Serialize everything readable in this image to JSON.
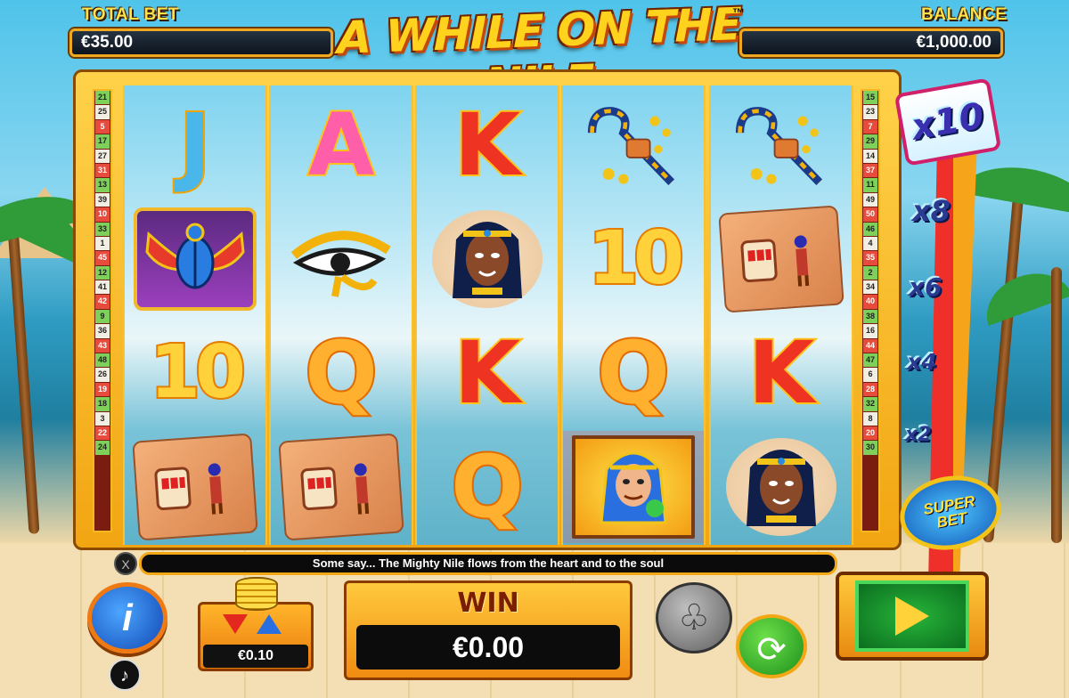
{
  "header": {
    "total_bet_label": "TOTAL BET",
    "total_bet_value": "€35.00",
    "balance_label": "BALANCE",
    "balance_value": "€1,000.00",
    "title": "A WHILE ON THE NILE",
    "trademark": "™"
  },
  "paylines": {
    "left": [
      "21",
      "25",
      "5",
      "17",
      "27",
      "31",
      "13",
      "39",
      "10",
      "33",
      "1",
      "45",
      "12",
      "41",
      "42",
      "9",
      "36",
      "43",
      "48",
      "26",
      "19",
      "18",
      "3",
      "22",
      "24"
    ],
    "right": [
      "15",
      "23",
      "7",
      "29",
      "14",
      "37",
      "11",
      "49",
      "50",
      "46",
      "4",
      "35",
      "2",
      "34",
      "40",
      "38",
      "16",
      "44",
      "47",
      "6",
      "28",
      "32",
      "8",
      "20",
      "30"
    ]
  },
  "reels": [
    [
      "J",
      "scarab",
      "10",
      "tablet"
    ],
    [
      "A",
      "eye-of-ra",
      "Q",
      "tablet"
    ],
    [
      "K",
      "cleopatra",
      "K",
      "Q"
    ],
    [
      "crook",
      "10",
      "Q",
      "pharaoh"
    ],
    [
      "crook",
      "tablet",
      "K",
      "cleopatra"
    ]
  ],
  "multipliers": {
    "top": "x10",
    "steps": [
      "x8",
      "x6",
      "x4",
      "x2"
    ],
    "superbet_line1": "SUPER",
    "superbet_line2": "BET"
  },
  "message": "Some say... The Mighty Nile flows from the heart and to the soul",
  "controls": {
    "close_glyph": "X",
    "info_glyph": "i",
    "music_glyph": "♪",
    "coin_value": "€0.10",
    "win_label": "WIN",
    "win_value": "€0.00",
    "gamble_glyph": "♧",
    "autoplay_glyph": "⟳"
  },
  "colors": {
    "frame_gold": "#f2a512",
    "accent_red": "#ef2f2a",
    "spin_green": "#27b53a"
  }
}
